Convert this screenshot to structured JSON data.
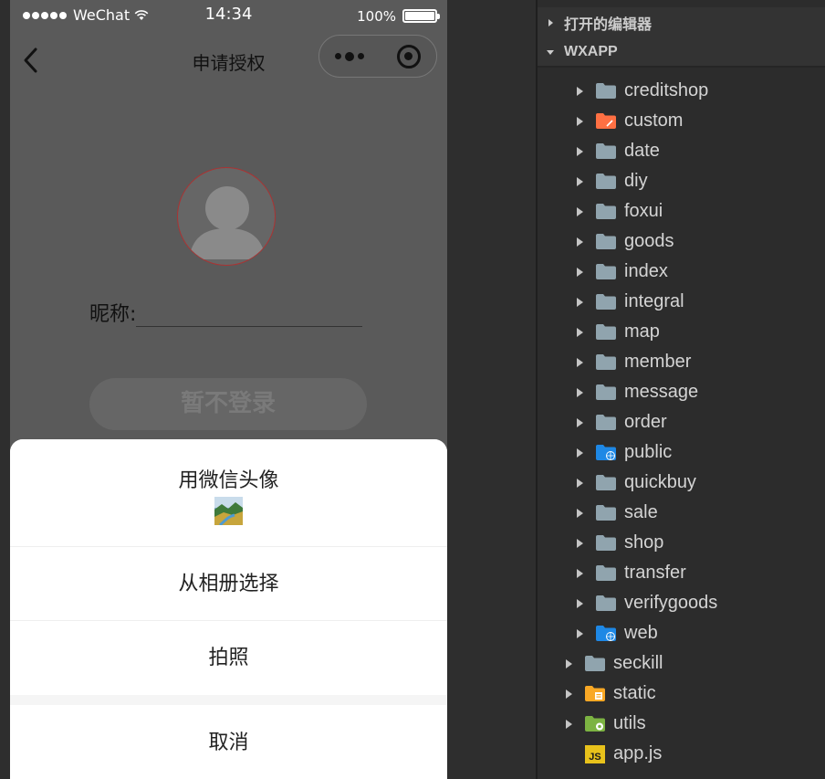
{
  "status_bar": {
    "carrier": "WeChat",
    "time": "14:34",
    "battery": "100%"
  },
  "nav": {
    "title": "申请授权"
  },
  "profile": {
    "nickname_label": "昵称:",
    "nickname_value": ""
  },
  "skip_button": "暂不登录",
  "action_sheet": {
    "use_wechat_avatar": "用微信头像",
    "choose_from_album": "从相册选择",
    "take_photo": "拍照",
    "cancel": "取消"
  },
  "explorer": {
    "open_editors": "打开的编辑器",
    "project": "WXAPP",
    "subfolders": [
      {
        "label": "creditshop",
        "icon": "folder-icon"
      },
      {
        "label": "custom",
        "icon": "folder-custom-icon"
      },
      {
        "label": "date",
        "icon": "folder-icon"
      },
      {
        "label": "diy",
        "icon": "folder-icon"
      },
      {
        "label": "foxui",
        "icon": "folder-icon"
      },
      {
        "label": "goods",
        "icon": "folder-icon"
      },
      {
        "label": "index",
        "icon": "folder-icon"
      },
      {
        "label": "integral",
        "icon": "folder-icon"
      },
      {
        "label": "map",
        "icon": "folder-icon"
      },
      {
        "label": "member",
        "icon": "folder-icon"
      },
      {
        "label": "message",
        "icon": "folder-icon"
      },
      {
        "label": "order",
        "icon": "folder-icon"
      },
      {
        "label": "public",
        "icon": "folder-public-icon"
      },
      {
        "label": "quickbuy",
        "icon": "folder-icon"
      },
      {
        "label": "sale",
        "icon": "folder-icon"
      },
      {
        "label": "shop",
        "icon": "folder-icon"
      },
      {
        "label": "transfer",
        "icon": "folder-icon"
      },
      {
        "label": "verifygoods",
        "icon": "folder-icon"
      },
      {
        "label": "web",
        "icon": "folder-public-icon"
      }
    ],
    "top_folders": [
      {
        "label": "seckill",
        "icon": "folder-icon"
      },
      {
        "label": "static",
        "icon": "folder-static-icon"
      },
      {
        "label": "utils",
        "icon": "folder-utils-icon"
      }
    ],
    "files": [
      {
        "label": "app.js",
        "badge": "JS",
        "icon": "js-file-icon"
      }
    ]
  },
  "colors": {
    "folder": "#90a4ae",
    "folder_custom": "#ff7043",
    "folder_public": "#1e88e5",
    "folder_static": "#f9a825",
    "folder_utils": "#7cb342",
    "js": "#e8c21b",
    "avatar_border": "#aa3333"
  }
}
